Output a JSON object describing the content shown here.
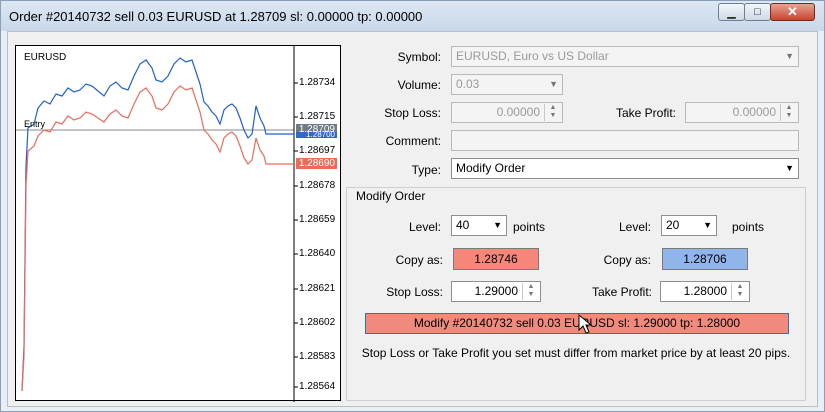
{
  "window": {
    "title": "Order #20140732 sell 0.03 EURUSD at 1.28709 sl: 0.00000 tp: 0.00000"
  },
  "chart": {
    "symbol": "EURUSD",
    "entry_label": "Entry",
    "price_ticks": [
      "1.28734",
      "1.28715",
      "1.28697",
      "1.28678",
      "1.28659",
      "1.28640",
      "1.28621",
      "1.28602",
      "1.28583",
      "1.28564"
    ],
    "bid_box": "1.28709",
    "ask_box": "1.28700",
    "red_box": "1.28690",
    "colors": {
      "ask_line": "#1f5fd1",
      "bid_line": "#f06a5a",
      "entry_line": "#8a8a8a",
      "grid": "#000000"
    }
  },
  "form": {
    "symbol_label": "Symbol:",
    "symbol_value": "EURUSD, Euro vs US Dollar",
    "volume_label": "Volume:",
    "volume_value": "0.03",
    "stoploss_label": "Stop Loss:",
    "stoploss_value": "0.00000",
    "takeprofit_label": "Take Profit:",
    "takeprofit_value": "0.00000",
    "comment_label": "Comment:",
    "comment_value": "",
    "type_label": "Type:",
    "type_value": "Modify Order"
  },
  "modify": {
    "group_label": "Modify Order",
    "level_label": "Level:",
    "level_left_value": "40",
    "level_right_value": "20",
    "points_label": "points",
    "copy_as_label": "Copy as:",
    "copy_left_value": "1.28746",
    "copy_right_value": "1.28706",
    "sl_label": "Stop Loss:",
    "sl_value": "1.29000",
    "tp_label": "Take Profit:",
    "tp_value": "1.28000",
    "modify_button": "Modify #20140732 sell 0.03 EURUSD sl: 1.29000 tp: 1.28000",
    "note": "Stop Loss or Take Profit you set must differ from market price by at least 20 pips."
  }
}
